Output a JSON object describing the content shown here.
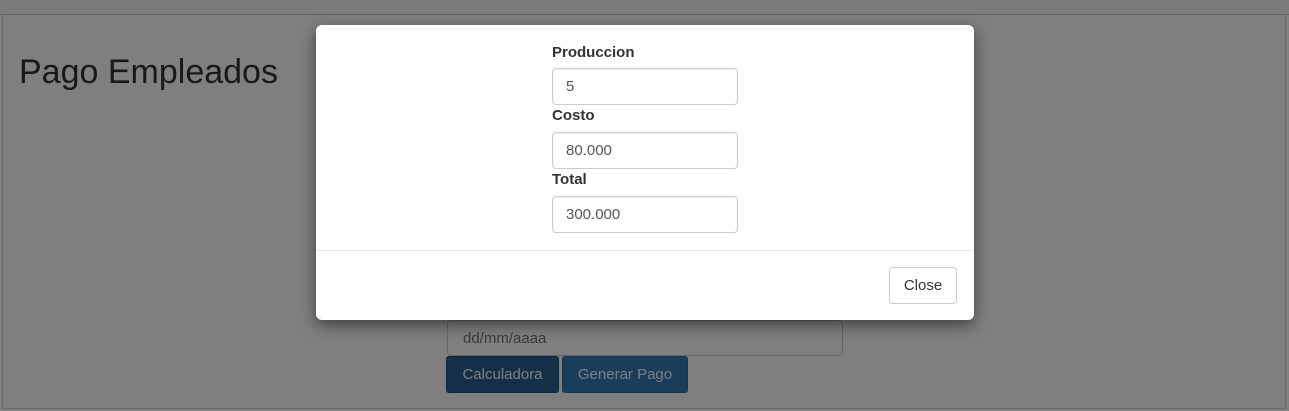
{
  "page": {
    "title": "Pago Empleados",
    "date_input": {
      "placeholder": "dd/mm/aaaa",
      "value": ""
    },
    "buttons": {
      "calculadora": "Calculadora",
      "generar_pago": "Generar Pago"
    }
  },
  "modal": {
    "fields": {
      "produccion": {
        "label": "Produccion",
        "value": "5"
      },
      "costo": {
        "label": "Costo",
        "value": "80.000"
      },
      "total": {
        "label": "Total",
        "value": "300.000"
      }
    },
    "close_label": "Close"
  },
  "colors": {
    "primary": "#337ab7",
    "primary_active": "#286090",
    "backdrop": "rgba(0,0,0,0.5)"
  }
}
